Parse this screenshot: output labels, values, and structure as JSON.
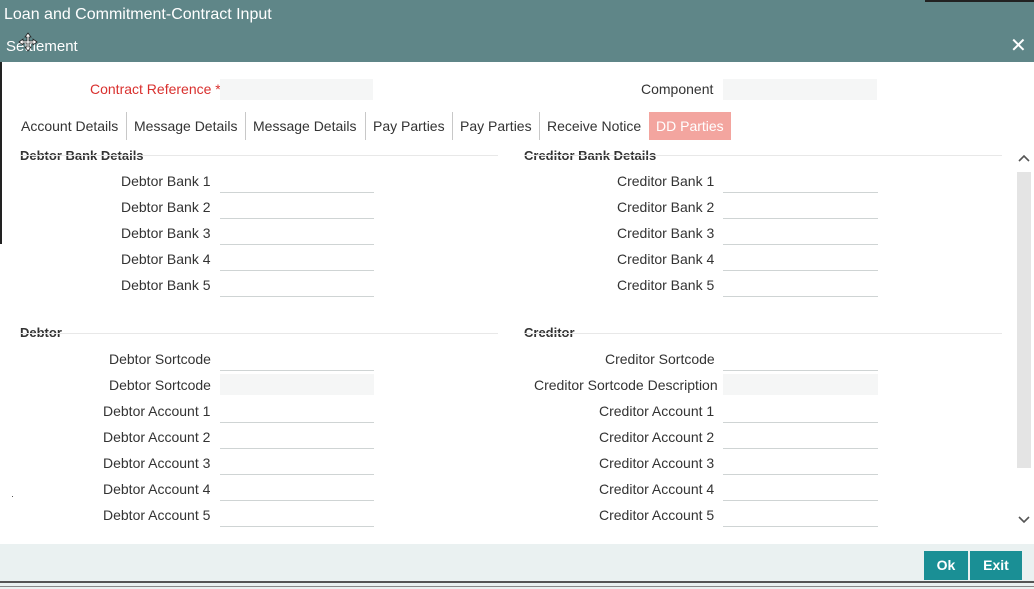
{
  "window": {
    "title": "Loan and Commitment-Contract Input"
  },
  "dialog": {
    "title": "Settlement",
    "close_label": "✕"
  },
  "header": {
    "contract_reference_label": "Contract Reference",
    "required_marker": "*",
    "contract_reference_value": "",
    "component_label": "Component",
    "component_value": ""
  },
  "tabs": [
    {
      "label": "Account Details"
    },
    {
      "label": "Message Details"
    },
    {
      "label": "Message Details"
    },
    {
      "label": "Pay Parties"
    },
    {
      "label": "Pay Parties"
    },
    {
      "label": "Receive Notice"
    },
    {
      "label": "DD Parties",
      "active": true
    }
  ],
  "debtor_bank": {
    "title": "Debtor Bank Details",
    "fields": [
      {
        "label": "Debtor Bank 1",
        "value": ""
      },
      {
        "label": "Debtor Bank 2",
        "value": ""
      },
      {
        "label": "Debtor Bank 3",
        "value": ""
      },
      {
        "label": "Debtor Bank 4",
        "value": ""
      },
      {
        "label": "Debtor Bank 5",
        "value": ""
      }
    ]
  },
  "creditor_bank": {
    "title": "Creditor Bank Details",
    "fields": [
      {
        "label": "Creditor Bank 1",
        "value": ""
      },
      {
        "label": "Creditor Bank 2",
        "value": ""
      },
      {
        "label": "Creditor Bank 3",
        "value": ""
      },
      {
        "label": "Creditor Bank 4",
        "value": ""
      },
      {
        "label": "Creditor Bank 5",
        "value": ""
      }
    ]
  },
  "debtor": {
    "title": "Debtor",
    "fields": [
      {
        "label": "Debtor Sortcode",
        "value": ""
      },
      {
        "label": "Debtor Sortcode",
        "value": "",
        "readonly": true
      },
      {
        "label": "Debtor Account 1",
        "value": ""
      },
      {
        "label": "Debtor Account 2",
        "value": ""
      },
      {
        "label": "Debtor Account 3",
        "value": ""
      },
      {
        "label": "Debtor Account 4",
        "value": ""
      },
      {
        "label": "Debtor Account 5",
        "value": ""
      }
    ]
  },
  "creditor": {
    "title": "Creditor",
    "fields": [
      {
        "label": "Creditor Sortcode",
        "value": ""
      },
      {
        "label": "Creditor Sortcode Description",
        "value": "",
        "readonly": true
      },
      {
        "label": "Creditor Account 1",
        "value": ""
      },
      {
        "label": "Creditor Account 2",
        "value": ""
      },
      {
        "label": "Creditor Account 3",
        "value": ""
      },
      {
        "label": "Creditor Account 4",
        "value": ""
      },
      {
        "label": "Creditor Account 5",
        "value": ""
      }
    ]
  },
  "scroll": {
    "up_icon": "chevron-up-icon",
    "down_icon": "chevron-down-icon"
  },
  "footer": {
    "ok_label": "Ok",
    "exit_label": "Exit"
  },
  "colors": {
    "title_bar": "#5f8688",
    "active_tab": "#f3a59f",
    "required": "#d9302e",
    "button": "#1a8f95",
    "footer": "#eaf1f1"
  }
}
